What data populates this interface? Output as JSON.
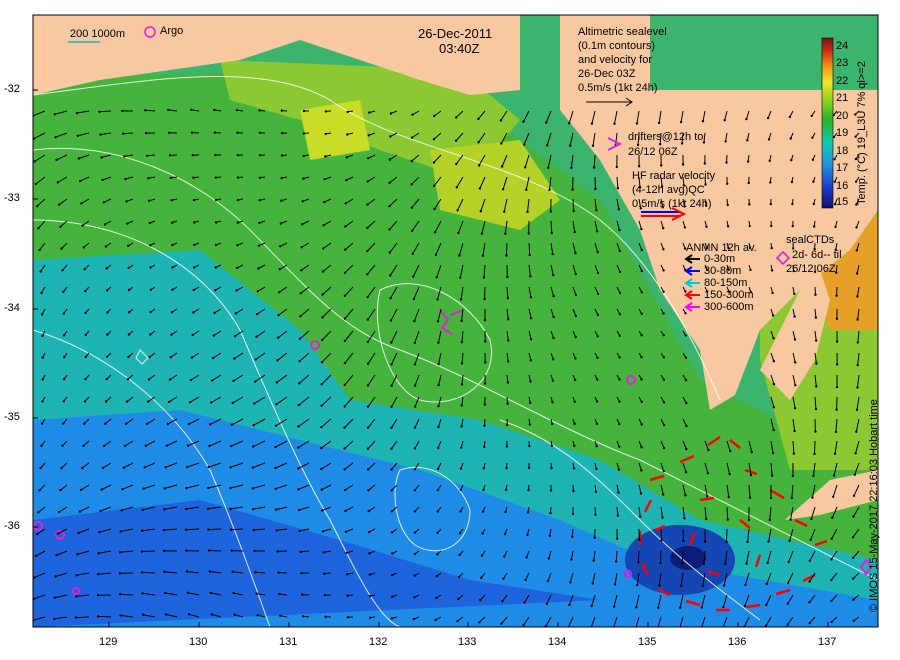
{
  "date": "26-Dec-2011",
  "time": "03:40Z",
  "scale_label": "200  1000m",
  "argo_label": "Argo",
  "altimetry": [
    "Altimetric sealevel",
    "(0.1m contours)",
    "and velocity for",
    "26-Dec 03Z",
    "0.5m/s (1kt 24h)"
  ],
  "drifters": [
    "drifters@12h to",
    "26/12 06Z"
  ],
  "hf_radar": [
    "HF radar velocity",
    "(4-12h avg)QC",
    "0.5m/s (1kt 24h)"
  ],
  "anmn": {
    "title": "ANMN 12h av.",
    "items": [
      {
        "label": "0-30m",
        "color": "#000000"
      },
      {
        "label": "30-80m",
        "color": "#0000ff"
      },
      {
        "label": "80-150m",
        "color": "#00cccc"
      },
      {
        "label": "150-300m",
        "color": "#ff0000"
      },
      {
        "label": "300-600m",
        "color": "#ff00ff"
      }
    ]
  },
  "sealctd": [
    "sealCTDs",
    "2d- 6d-- til",
    "26/12 06Z"
  ],
  "colorbar": {
    "title": "Temp. (°C) 19_L3U 7% ql>=2",
    "ticks": [
      "24",
      "23",
      "22",
      "21",
      "20",
      "19",
      "18",
      "17",
      "16",
      "15"
    ]
  },
  "lat_labels": [
    "-32",
    "-33",
    "-34",
    "-35",
    "-36"
  ],
  "lon_labels": [
    "129",
    "130",
    "131",
    "132",
    "133",
    "134",
    "135",
    "136",
    "137"
  ],
  "credit": "© IMOS 15-May-2017 22:16:03 Hobart time",
  "colors": {
    "land": "#f8c9a0",
    "argo": "#dd22dd",
    "hf": "#ff0000"
  }
}
